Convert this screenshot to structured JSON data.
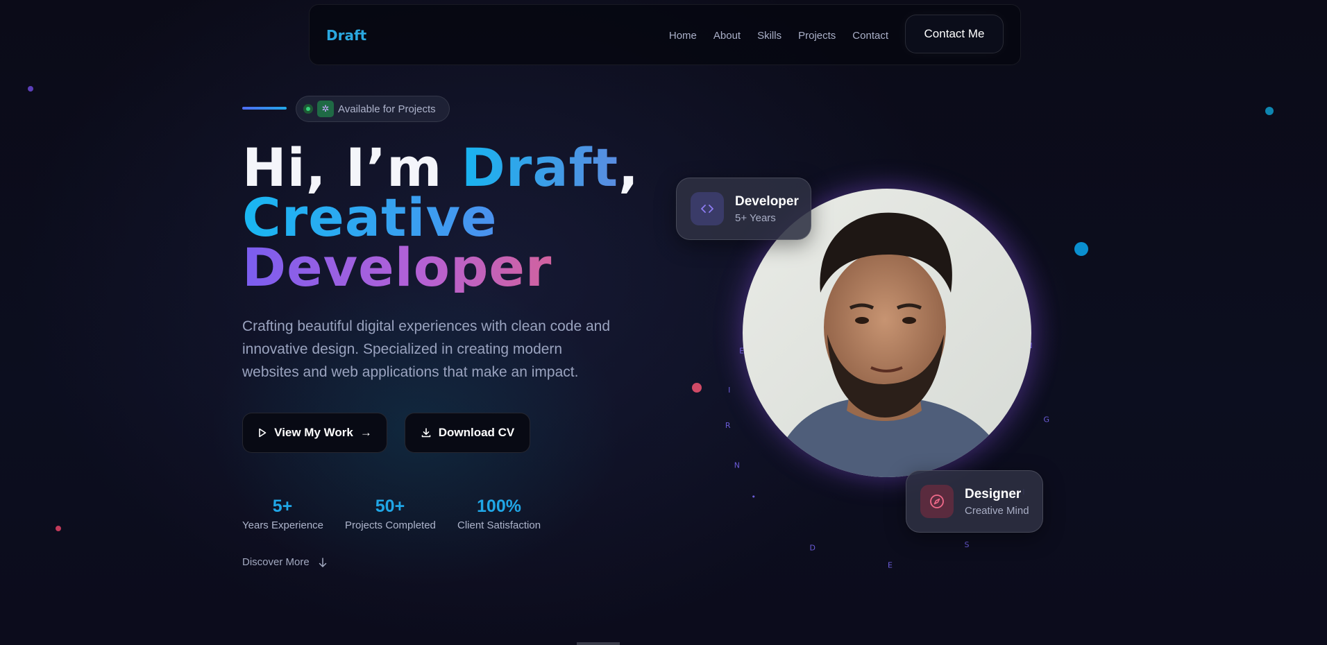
{
  "nav": {
    "brand": "Draft",
    "links": [
      "Home",
      "About",
      "Skills",
      "Projects",
      "Contact"
    ],
    "cta": "Contact Me"
  },
  "badge": {
    "text": "Available for Projects"
  },
  "hero": {
    "line1_white": "Hi, I’m ",
    "line1_accent": "Draft",
    "line1_comma": ",",
    "line2": "Creative",
    "line3": "Developer",
    "description": "Crafting beautiful digital experiences with clean code and innovative design. Specialized in creating modern websites and web applications that make an impact.",
    "primary_button": "View My Work",
    "secondary_button": "Download CV"
  },
  "stats": [
    {
      "value": "5+",
      "label": "Years Experience"
    },
    {
      "value": "50+",
      "label": "Projects Completed"
    },
    {
      "value": "100%",
      "label": "Client Satisfaction"
    }
  ],
  "discover": "Discover More",
  "cards": {
    "developer": {
      "title": "Developer",
      "subtitle": "5+ Years"
    },
    "designer": {
      "title": "Designer",
      "subtitle": "Creative Mind"
    }
  },
  "ring_text": "NI•REENGISED•REPOLE",
  "colors": {
    "accent_blue": "#20a6e6",
    "accent_purple": "#7a5ef0",
    "accent_pink": "#e2637e",
    "background": "#0b0c1a"
  },
  "icons": [
    "play-icon",
    "arrow-right-icon",
    "download-icon",
    "code-icon",
    "compass-icon",
    "arrow-down-icon",
    "sparkle-icon"
  ]
}
